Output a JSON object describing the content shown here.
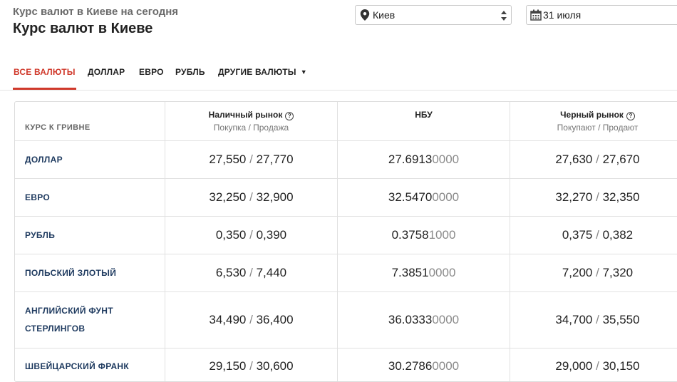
{
  "header": {
    "subtitle": "Курс валют в Киеве на сегодня",
    "title": "Курс валют в Киеве"
  },
  "filters": {
    "city": "Киев",
    "date": "31 июля"
  },
  "tabs": [
    {
      "label": "ВСЕ ВАЛЮТЫ",
      "active": true
    },
    {
      "label": "ДОЛЛАР",
      "active": false
    },
    {
      "label": "ЕВРО",
      "active": false
    },
    {
      "label": "РУБЛЬ",
      "active": false
    },
    {
      "label": "ДРУГИЕ ВАЛЮТЫ",
      "active": false
    }
  ],
  "table": {
    "columns": {
      "currency": "КУРС К ГРИВНЕ",
      "cash": {
        "title": "Наличный рынок",
        "sub": "Покупка / Продажа"
      },
      "nbu": {
        "title": "НБУ"
      },
      "black": {
        "title": "Черный рынок",
        "sub": "Покупают / Продают"
      }
    },
    "separator": "/",
    "rows": [
      {
        "name_lines": [
          "ДОЛЛАР"
        ],
        "cash_buy": "27,550",
        "cash_sell": "27,770",
        "nbu_main": "27.6913",
        "nbu_tail": "0000",
        "black_buy": "27,630",
        "black_sell": "27,670"
      },
      {
        "name_lines": [
          "ЕВРО"
        ],
        "cash_buy": "32,250",
        "cash_sell": "32,900",
        "nbu_main": "32.5470",
        "nbu_tail": "0000",
        "black_buy": "32,270",
        "black_sell": "32,350"
      },
      {
        "name_lines": [
          "РУБЛЬ"
        ],
        "cash_buy": "0,350",
        "cash_sell": "0,390",
        "nbu_main": "0.3758",
        "nbu_tail": "1000",
        "black_buy": "0,375",
        "black_sell": "0,382"
      },
      {
        "name_lines": [
          "ПОЛЬСКИЙ ЗЛОТЫЙ"
        ],
        "cash_buy": "6,530",
        "cash_sell": "7,440",
        "nbu_main": "7.3851",
        "nbu_tail": "0000",
        "black_buy": "7,200",
        "black_sell": "7,320"
      },
      {
        "name_lines": [
          "АНГЛИЙСКИЙ ФУНТ",
          "СТЕРЛИНГОВ"
        ],
        "cash_buy": "34,490",
        "cash_sell": "36,400",
        "nbu_main": "36.0333",
        "nbu_tail": "0000",
        "black_buy": "34,700",
        "black_sell": "35,550"
      },
      {
        "name_lines": [
          "ШВЕЙЦАРСКИЙ ФРАНК"
        ],
        "cash_buy": "29,150",
        "cash_sell": "30,600",
        "nbu_main": "30.2786",
        "nbu_tail": "0000",
        "black_buy": "29,000",
        "black_sell": "30,150"
      }
    ]
  }
}
